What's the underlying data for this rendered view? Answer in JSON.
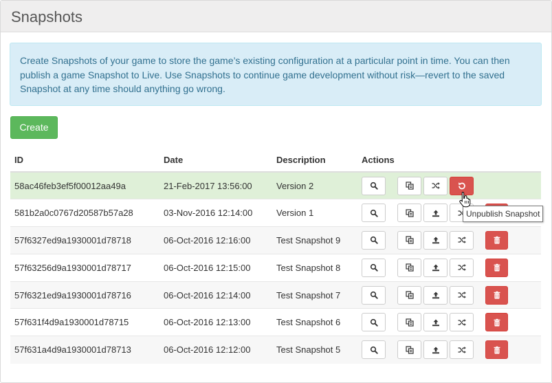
{
  "page": {
    "title": "Snapshots",
    "info": "Create Snapshots of your game to store the game’s existing configuration at a particular point in time. You can then publish a game Snapshot to Live. Use Snapshots to continue game development without risk—revert to the saved Snapshot at any time should anything go wrong.",
    "create_label": "Create"
  },
  "table": {
    "headers": {
      "id": "ID",
      "date": "Date",
      "description": "Description",
      "actions": "Actions"
    },
    "rows": [
      {
        "id": "58ac46feb3ef5f00012aa49a",
        "date": "21-Feb-2017 13:56:00",
        "description": "Version 2",
        "state": "live"
      },
      {
        "id": "581b2a0c0767d20587b57a28",
        "date": "03-Nov-2016 12:14:00",
        "description": "Version 1",
        "state": "normal"
      },
      {
        "id": "57f6327ed9a1930001d78718",
        "date": "06-Oct-2016 12:16:00",
        "description": "Test Snapshot 9",
        "state": "normal"
      },
      {
        "id": "57f63256d9a1930001d78717",
        "date": "06-Oct-2016 12:15:00",
        "description": "Test Snapshot 8",
        "state": "normal"
      },
      {
        "id": "57f6321ed9a1930001d78716",
        "date": "06-Oct-2016 12:14:00",
        "description": "Test Snapshot 7",
        "state": "normal"
      },
      {
        "id": "57f631f4d9a1930001d78715",
        "date": "06-Oct-2016 12:13:00",
        "description": "Test Snapshot 6",
        "state": "normal"
      },
      {
        "id": "57f631a4d9a1930001d78713",
        "date": "06-Oct-2016 12:12:00",
        "description": "Test Snapshot 5",
        "state": "normal"
      }
    ]
  },
  "tooltip": {
    "text": "Unpublish Snapshot"
  },
  "icons": {
    "view": "magnifier-icon",
    "copy": "copy-icon",
    "publish": "upload-icon",
    "revert": "shuffle-icon",
    "unpublish": "undo-icon",
    "delete": "trash-icon"
  },
  "colors": {
    "success": "#5cb85c",
    "danger": "#d9534f",
    "info_bg": "#d9edf7",
    "info_text": "#31708f",
    "active_row": "#dff0d8"
  }
}
